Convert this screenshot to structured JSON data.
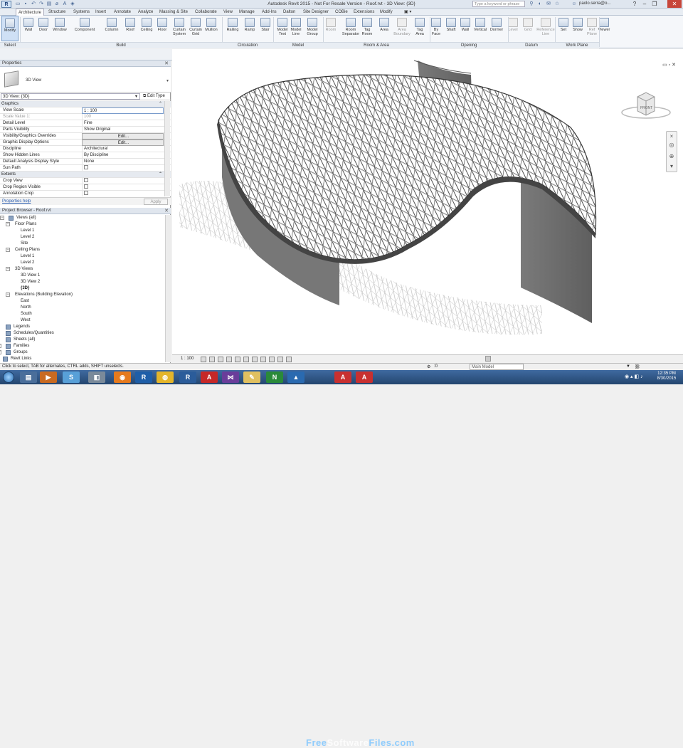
{
  "titlebar": {
    "title": "Autodesk Revit 2015  -  Not For Resale Version  -  Roof.rvt - 3D View: {3D}",
    "search_placeholder": "Type a keyword or phrase",
    "user": "paolo.serra@o...",
    "app_letter": "R"
  },
  "tabs": [
    "Architecture",
    "Structure",
    "Systems",
    "Insert",
    "Annotate",
    "Analyze",
    "Massing & Site",
    "Collaborate",
    "View",
    "Manage",
    "Add-Ins",
    "Dalton",
    "Site Designer",
    "COBie",
    "Extensions",
    "Modify"
  ],
  "ribbon": {
    "buttons": [
      {
        "label": "Modify",
        "icon": "cursor-icon"
      },
      {
        "label": "Wall",
        "icon": "wall-icon"
      },
      {
        "label": "Door",
        "icon": "door-icon"
      },
      {
        "label": "Window",
        "icon": "window-icon"
      },
      {
        "label": "Component",
        "icon": "component-icon"
      },
      {
        "label": "Column",
        "icon": "column-icon"
      },
      {
        "label": "Roof",
        "icon": "roof-icon"
      },
      {
        "label": "Ceiling",
        "icon": "ceiling-icon"
      },
      {
        "label": "Floor",
        "icon": "floor-icon"
      },
      {
        "label": "Curtain System",
        "icon": "curtain-system-icon"
      },
      {
        "label": "Curtain Grid",
        "icon": "curtain-grid-icon"
      },
      {
        "label": "Mullion",
        "icon": "mullion-icon"
      },
      {
        "label": "Railing",
        "icon": "railing-icon"
      },
      {
        "label": "Ramp",
        "icon": "ramp-icon"
      },
      {
        "label": "Stair",
        "icon": "stair-icon"
      },
      {
        "label": "Model Text",
        "icon": "model-text-icon"
      },
      {
        "label": "Model Line",
        "icon": "model-line-icon"
      },
      {
        "label": "Model Group",
        "icon": "model-group-icon"
      },
      {
        "label": "Room",
        "icon": "room-icon"
      },
      {
        "label": "Room Separator",
        "icon": "room-separator-icon"
      },
      {
        "label": "Tag Room",
        "icon": "tag-room-icon"
      },
      {
        "label": "Area",
        "icon": "area-icon"
      },
      {
        "label": "Area Boundary",
        "icon": "area-boundary-icon"
      },
      {
        "label": "Tag Area",
        "icon": "tag-area-icon"
      },
      {
        "label": "By Face",
        "icon": "by-face-icon"
      },
      {
        "label": "Shaft",
        "icon": "shaft-icon"
      },
      {
        "label": "Wall",
        "icon": "wall-opening-icon"
      },
      {
        "label": "Vertical",
        "icon": "vertical-icon"
      },
      {
        "label": "Dormer",
        "icon": "dormer-icon"
      },
      {
        "label": "Level",
        "icon": "level-icon"
      },
      {
        "label": "Grid",
        "icon": "grid-icon"
      },
      {
        "label": "Reference Line",
        "icon": "reference-line-icon"
      },
      {
        "label": "Set",
        "icon": "set-icon"
      },
      {
        "label": "Show",
        "icon": "show-icon"
      },
      {
        "label": "Ref Plane",
        "icon": "ref-plane-icon"
      },
      {
        "label": "Viewer",
        "icon": "viewer-icon"
      }
    ],
    "groups": [
      "Select",
      "Build",
      "Circulation",
      "Model",
      "Room & Area",
      "Opening",
      "Datum",
      "Work Plane"
    ]
  },
  "properties": {
    "header": "Properties",
    "type_name": "3D View",
    "view_select": "3D View: {3D}",
    "edit_type": "Edit Type",
    "rows": [
      {
        "k": "Graphics",
        "v": ""
      },
      {
        "k": "View Scale",
        "v": "1 : 100"
      },
      {
        "k": "Scale Value    1:",
        "v": "100"
      },
      {
        "k": "Detail Level",
        "v": "Fine"
      },
      {
        "k": "Parts Visibility",
        "v": "Show Original"
      },
      {
        "k": "Visibility/Graphics Overrides",
        "v": "Edit..."
      },
      {
        "k": "Graphic Display Options",
        "v": "Edit..."
      },
      {
        "k": "Discipline",
        "v": "Architectural"
      },
      {
        "k": "Show Hidden Lines",
        "v": "By Discipline"
      },
      {
        "k": "Default Analysis Display Style",
        "v": "None"
      },
      {
        "k": "Sun Path",
        "v": ""
      },
      {
        "k": "Extents",
        "v": ""
      },
      {
        "k": "Crop View",
        "v": ""
      },
      {
        "k": "Crop Region Visible",
        "v": ""
      },
      {
        "k": "Annotation Crop",
        "v": ""
      }
    ],
    "help": "Properties help",
    "apply": "Apply"
  },
  "project_browser": {
    "header": "Project Browser - Roof.rvt",
    "nodes": [
      {
        "label": "Views (all)",
        "toggle": "−"
      },
      {
        "label": "Floor Plans",
        "toggle": "−"
      },
      {
        "label": "Level 1",
        "toggle": ""
      },
      {
        "label": "Level 2",
        "toggle": ""
      },
      {
        "label": "Site",
        "toggle": ""
      },
      {
        "label": "Ceiling Plans",
        "toggle": "−"
      },
      {
        "label": "Level 1",
        "toggle": ""
      },
      {
        "label": "Level 2",
        "toggle": ""
      },
      {
        "label": "3D Views",
        "toggle": "−"
      },
      {
        "label": "3D View 1",
        "toggle": ""
      },
      {
        "label": "3D View 2",
        "toggle": ""
      },
      {
        "label": "{3D}",
        "toggle": ""
      },
      {
        "label": "Elevations (Building Elevation)",
        "toggle": "−"
      },
      {
        "label": "East",
        "toggle": ""
      },
      {
        "label": "North",
        "toggle": ""
      },
      {
        "label": "South",
        "toggle": ""
      },
      {
        "label": "West",
        "toggle": ""
      },
      {
        "label": "Legends",
        "toggle": ""
      },
      {
        "label": "Schedules/Quantities",
        "toggle": ""
      },
      {
        "label": "Sheets (all)",
        "toggle": ""
      },
      {
        "label": "Families",
        "toggle": "+"
      },
      {
        "label": "Groups",
        "toggle": "+"
      },
      {
        "label": "Revit Links",
        "toggle": ""
      }
    ]
  },
  "viewport": {
    "viewcube_face": "FRONT"
  },
  "viewbar": {
    "scale": "1 : 100"
  },
  "status": {
    "text": "Click to select, TAB for alternates, CTRL adds, SHIFT unselects.",
    "model": "Main Model",
    "zoom": ":0"
  },
  "taskbar": {
    "time": "12:35 PM",
    "date": "8/30/2015"
  },
  "watermark": {
    "part1": "Free",
    "part2": "Software",
    "part3": "Files.com"
  }
}
